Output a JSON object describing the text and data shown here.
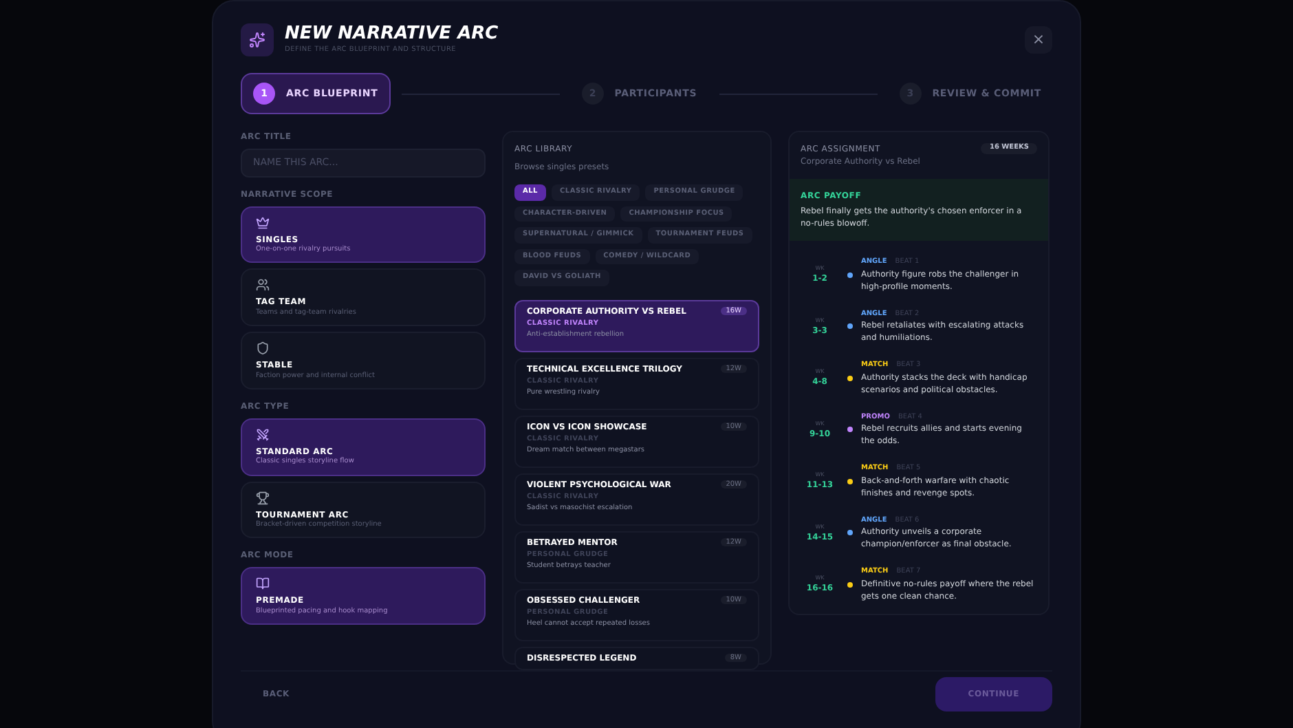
{
  "header": {
    "title": "NEW NARRATIVE ARC",
    "subtitle": "DEFINE THE ARC BLUEPRINT AND STRUCTURE",
    "close": "×"
  },
  "steps": [
    {
      "number": "1",
      "label": "ARC BLUEPRINT",
      "selected": true
    },
    {
      "number": "2",
      "label": "PARTICIPANTS",
      "selected": false
    },
    {
      "number": "3",
      "label": "REVIEW & COMMIT",
      "selected": false
    }
  ],
  "arc_title": {
    "label": "ARC TITLE",
    "placeholder": "NAME THIS ARC..."
  },
  "sections": [
    {
      "label": "NARRATIVE SCOPE",
      "options": [
        {
          "title": "SINGLES",
          "desc": "One-on-one rivalry pursuits",
          "selected": true
        },
        {
          "title": "TAG TEAM",
          "desc": "Teams and tag-team rivalries",
          "selected": false
        },
        {
          "title": "STABLE",
          "desc": "Faction power and internal conflict",
          "selected": false
        }
      ]
    },
    {
      "label": "ARC TYPE",
      "options": [
        {
          "title": "STANDARD ARC",
          "desc": "Classic singles storyline flow",
          "selected": true
        },
        {
          "title": "TOURNAMENT ARC",
          "desc": "Bracket-driven competition storyline",
          "selected": false
        }
      ]
    },
    {
      "label": "ARC MODE",
      "options": [
        {
          "title": "PREMADE",
          "desc": "Blueprinted pacing and hook mapping",
          "selected": true
        }
      ]
    }
  ],
  "library": {
    "title": "ARC LIBRARY",
    "subtitle": "Browse singles presets",
    "filters": [
      {
        "label": "ALL",
        "selected": true
      },
      {
        "label": "CLASSIC RIVALRY",
        "selected": false
      },
      {
        "label": "PERSONAL GRUDGE",
        "selected": false
      },
      {
        "label": "CHARACTER-DRIVEN",
        "selected": false
      },
      {
        "label": "CHAMPIONSHIP FOCUS",
        "selected": false
      },
      {
        "label": "SUPERNATURAL / GIMMICK",
        "selected": false
      },
      {
        "label": "TOURNAMENT FEUDS",
        "selected": false
      },
      {
        "label": "BLOOD FEUDS",
        "selected": false
      },
      {
        "label": "COMEDY / WILDCARD",
        "selected": false
      },
      {
        "label": "DAVID VS GOLIATH",
        "selected": false
      }
    ],
    "items": [
      {
        "title": "CORPORATE AUTHORITY VS REBEL",
        "category": "CLASSIC RIVALRY",
        "desc": "Anti-establishment rebellion",
        "weeks": "16W",
        "selected": true
      },
      {
        "title": "TECHNICAL EXCELLENCE TRILOGY",
        "category": "CLASSIC RIVALRY",
        "desc": "Pure wrestling rivalry",
        "weeks": "12W",
        "selected": false
      },
      {
        "title": "ICON VS ICON SHOWCASE",
        "category": "CLASSIC RIVALRY",
        "desc": "Dream match between megastars",
        "weeks": "10W",
        "selected": false
      },
      {
        "title": "VIOLENT PSYCHOLOGICAL WAR",
        "category": "CLASSIC RIVALRY",
        "desc": "Sadist vs masochist escalation",
        "weeks": "20W",
        "selected": false
      },
      {
        "title": "BETRAYED MENTOR",
        "category": "PERSONAL GRUDGE",
        "desc": "Student betrays teacher",
        "weeks": "12W",
        "selected": false
      },
      {
        "title": "OBSESSED CHALLENGER",
        "category": "PERSONAL GRUDGE",
        "desc": "Heel cannot accept repeated losses",
        "weeks": "10W",
        "selected": false
      },
      {
        "title": "DISRESPECTED LEGEND",
        "weeks": "8W",
        "selected": false
      }
    ]
  },
  "assignment": {
    "title": "ARC ASSIGNMENT",
    "subtitle": "Corporate Authority vs Rebel",
    "duration": "16 WEEKS",
    "payoff_label": "ARC PAYOFF",
    "payoff": "Rebel finally gets the authority's chosen enforcer in a no-rules blowoff.",
    "beats": [
      {
        "wk": "WK",
        "range": "1-2",
        "kind": "angle",
        "type": "ANGLE",
        "beat": "BEAT 1",
        "text": "Authority figure robs the challenger in high-profile moments."
      },
      {
        "wk": "WK",
        "range": "3-3",
        "kind": "angle",
        "type": "ANGLE",
        "beat": "BEAT 2",
        "text": "Rebel retaliates with escalating attacks and humiliations."
      },
      {
        "wk": "WK",
        "range": "4-8",
        "kind": "match",
        "type": "MATCH",
        "beat": "BEAT 3",
        "text": "Authority stacks the deck with handicap scenarios and political obstacles."
      },
      {
        "wk": "WK",
        "range": "9-10",
        "kind": "promo",
        "type": "PROMO",
        "beat": "BEAT 4",
        "text": "Rebel recruits allies and starts evening the odds."
      },
      {
        "wk": "WK",
        "range": "11-13",
        "kind": "match",
        "type": "MATCH",
        "beat": "BEAT 5",
        "text": "Back-and-forth warfare with chaotic finishes and revenge spots."
      },
      {
        "wk": "WK",
        "range": "14-15",
        "kind": "angle",
        "type": "ANGLE",
        "beat": "BEAT 6",
        "text": "Authority unveils a corporate champion/enforcer as final obstacle."
      },
      {
        "wk": "WK",
        "range": "16-16",
        "kind": "match",
        "type": "MATCH",
        "beat": "BEAT 7",
        "text": "Definitive no-rules payoff where the rebel gets one clean chance."
      }
    ]
  },
  "footer": {
    "back": "BACK",
    "continue": "CONTINUE"
  }
}
